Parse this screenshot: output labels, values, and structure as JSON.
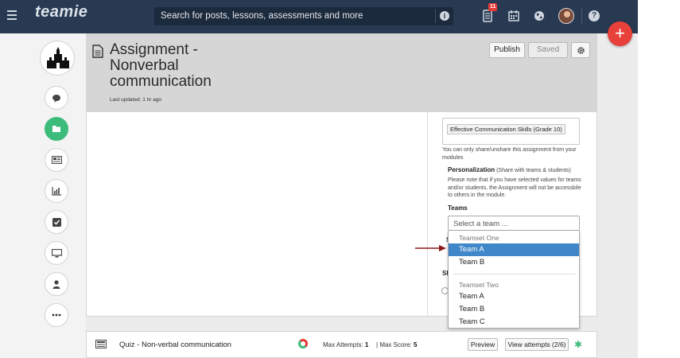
{
  "topbar": {
    "app_name": "teamie",
    "search_placeholder": "Search for posts, lessons, assessments and more",
    "notification_count": "11",
    "icons": [
      "menu-icon",
      "info-icon",
      "notifications-icon",
      "calendar-icon",
      "globe-icon",
      "avatar",
      "help-icon"
    ]
  },
  "fab": {
    "label": "+"
  },
  "sidebar": {
    "items": [
      "chat-icon",
      "folder-icon",
      "newspaper-icon",
      "bar-chart-icon",
      "checkbox-icon",
      "monitor-icon",
      "user-icon",
      "more-icon"
    ],
    "active_index": 1
  },
  "header": {
    "title": "Assignment - Nonverbal communication",
    "last_updated": "Last updated: 1 hr ago",
    "publish_label": "Publish",
    "saved_label": "Saved"
  },
  "sharing": {
    "module_tag": "Effective Communication Skills (Grade 10)",
    "share_note": "You can only share/unshare this assignment from your modules",
    "personalization_label": "Personalization",
    "personalization_hint": "(Share with teams & students)",
    "personalization_note": "Please note that if you have selected values for teams and/or students, the Assignment will not be accessbile to others in the module.",
    "teams_label": "Teams",
    "team_placeholder": "Select a team ...",
    "hidden_fragment_1": "S",
    "hidden_fragment_2": "Sh"
  },
  "dropdown": {
    "groups": [
      {
        "label": "Teamset One",
        "options": [
          "Team A",
          "Team B"
        ],
        "selected_index": 0
      },
      {
        "label": "Teamset Two",
        "options": [
          "Team A",
          "Team B",
          "Team C"
        ]
      }
    ]
  },
  "quiz": {
    "title": "Quiz - Non-verbal communication",
    "max_attempts_label": "Max Attempts:",
    "max_attempts_value": "1",
    "max_score_label": "Max Score:",
    "max_score_value": "5",
    "preview_label": "Preview",
    "view_attempts_label": "View attempts (2/6)"
  },
  "colors": {
    "topbar": "#283a52",
    "accent_green": "#3dbb7b",
    "fab_red": "#e8403a",
    "selected_blue": "#3f87c9",
    "arrow": "#8b1a1a"
  }
}
